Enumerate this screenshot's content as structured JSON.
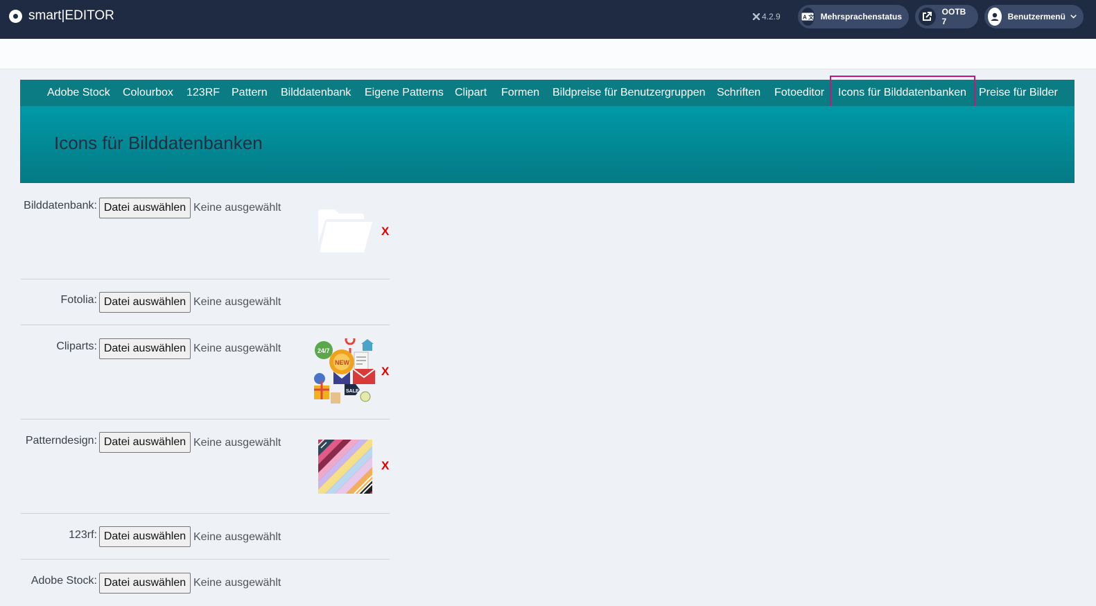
{
  "header": {
    "logo_text": "smart|EDITOR",
    "version": "4.2.9",
    "language_status_label": "Mehrsprachenstatus",
    "ootb_label": "OOTB 7",
    "user_menu_label": "Benutzermenü"
  },
  "nav": {
    "items": [
      "Adobe Stock",
      "Colourbox",
      "123RF",
      "Pattern",
      "Bilddatenbank",
      "Eigene Patterns",
      "Clipart",
      "Formen",
      "Bildpreise für Benutzergruppen",
      "Schriften",
      "Fotoeditor",
      "Icons für Bilddatenbanken",
      "Preise für Bilder"
    ],
    "active": "Icons für Bilddatenbanken"
  },
  "page": {
    "title": "Icons für Bilddatenbanken"
  },
  "form": {
    "button_label": "Datei auswählen",
    "no_file_label": "Keine ausgewählt",
    "delete_label": "X",
    "rows": [
      {
        "label": "Bilddatenbank:",
        "icon": "folder-icon"
      },
      {
        "label": "Fotolia:"
      },
      {
        "label": "Cliparts:",
        "icon": "clipart-collage-icon"
      },
      {
        "label": "Patterndesign:",
        "icon": "pattern-swatch-icon"
      },
      {
        "label": "123rf:"
      },
      {
        "label": "Adobe Stock:"
      }
    ]
  },
  "colors": {
    "topbar": "#1e2b43",
    "nav": "#0b7b84",
    "active_outline": "#c2187a",
    "delete": "#e00000"
  }
}
